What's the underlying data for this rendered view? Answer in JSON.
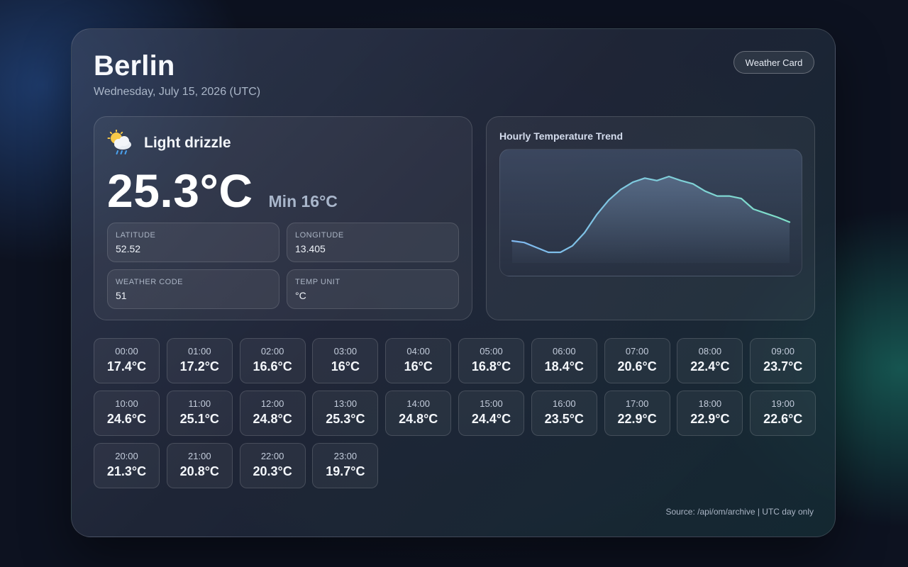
{
  "location": {
    "city": "Berlin",
    "date": "Wednesday, July 15, 2026 (UTC)"
  },
  "badge": {
    "label": "Weather Card"
  },
  "current": {
    "icon": "sun-behind-rain-cloud-icon",
    "condition": "Light drizzle",
    "temperature": "25.3°C",
    "min": "Min 16°C"
  },
  "stats": [
    {
      "label": "LATITUDE",
      "value": "52.52"
    },
    {
      "label": "LONGITUDE",
      "value": "13.405"
    },
    {
      "label": "WEATHER CODE",
      "value": "51"
    },
    {
      "label": "TEMP UNIT",
      "value": "°C"
    }
  ],
  "trend": {
    "title": "Hourly Temperature Trend",
    "line_color_start": "#7fb8f0",
    "line_color_end": "#7fe0c8"
  },
  "hourly": [
    {
      "time": "00:00",
      "temp": "17.4°C"
    },
    {
      "time": "01:00",
      "temp": "17.2°C"
    },
    {
      "time": "02:00",
      "temp": "16.6°C"
    },
    {
      "time": "03:00",
      "temp": "16°C"
    },
    {
      "time": "04:00",
      "temp": "16°C"
    },
    {
      "time": "05:00",
      "temp": "16.8°C"
    },
    {
      "time": "06:00",
      "temp": "18.4°C"
    },
    {
      "time": "07:00",
      "temp": "20.6°C"
    },
    {
      "time": "08:00",
      "temp": "22.4°C"
    },
    {
      "time": "09:00",
      "temp": "23.7°C"
    },
    {
      "time": "10:00",
      "temp": "24.6°C"
    },
    {
      "time": "11:00",
      "temp": "25.1°C"
    },
    {
      "time": "12:00",
      "temp": "24.8°C"
    },
    {
      "time": "13:00",
      "temp": "25.3°C"
    },
    {
      "time": "14:00",
      "temp": "24.8°C"
    },
    {
      "time": "15:00",
      "temp": "24.4°C"
    },
    {
      "time": "16:00",
      "temp": "23.5°C"
    },
    {
      "time": "17:00",
      "temp": "22.9°C"
    },
    {
      "time": "18:00",
      "temp": "22.9°C"
    },
    {
      "time": "19:00",
      "temp": "22.6°C"
    },
    {
      "time": "20:00",
      "temp": "21.3°C"
    },
    {
      "time": "21:00",
      "temp": "20.8°C"
    },
    {
      "time": "22:00",
      "temp": "20.3°C"
    },
    {
      "time": "23:00",
      "temp": "19.7°C"
    }
  ],
  "chart_data": {
    "type": "area",
    "x": [
      "00:00",
      "01:00",
      "02:00",
      "03:00",
      "04:00",
      "05:00",
      "06:00",
      "07:00",
      "08:00",
      "09:00",
      "10:00",
      "11:00",
      "12:00",
      "13:00",
      "14:00",
      "15:00",
      "16:00",
      "17:00",
      "18:00",
      "19:00",
      "20:00",
      "21:00",
      "22:00",
      "23:00"
    ],
    "series": [
      {
        "values": [
          17.4,
          17.2,
          16.6,
          16,
          16,
          16.8,
          18.4,
          20.6,
          22.4,
          23.7,
          24.6,
          25.1,
          24.8,
          25.3,
          24.8,
          24.4,
          23.5,
          22.9,
          22.9,
          22.6,
          21.3,
          20.8,
          20.3,
          19.7
        ]
      }
    ],
    "title": "Hourly Temperature Trend",
    "xlabel": "",
    "ylabel": "",
    "grid": false,
    "legend": "none"
  },
  "footer": {
    "source": "Source: /api/om/archive | UTC day only"
  }
}
